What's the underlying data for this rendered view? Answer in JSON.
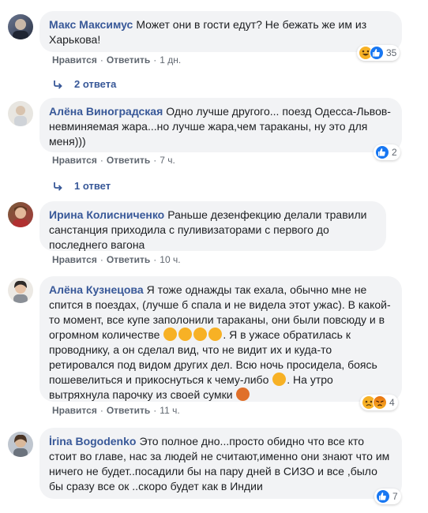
{
  "actions": {
    "like": "Нравится",
    "reply": "Ответить",
    "sep": "·"
  },
  "comments": [
    {
      "author": "Макс Максимус",
      "text": "Может они в гости едут? Не бежать же им из Харькова!",
      "time": "1 дн.",
      "reactions": [
        "haha-icon",
        "like-icon"
      ],
      "reaction_count": "35",
      "replies": "2 ответа"
    },
    {
      "author": "Алёна Виноградская",
      "text": "Одно лучше другого... поезд Одесса-Львов- невминяемая жара...но лучше жара,чем тараканы, ну это для меня)))",
      "time": "7 ч.",
      "reactions": [
        "like-icon"
      ],
      "reaction_count": "2",
      "replies": "1 ответ"
    },
    {
      "author": "Ирина Колисниченко",
      "text": "Раньше дезенфекцию делали травили санстанция приходила с пуливизаторами с первого до последнего вагона",
      "time": "10 ч."
    },
    {
      "author": "Алёна Кузнецова",
      "text_a": "Я тоже однажды так ехала, обычно мне не спится в поездах, (лучше б спала и не видела этот ужас). В какой-то момент, все купе заполонили тараканы, они были повсюду и в огромном количестве",
      "text_b": ". Я в ужасе обратилась к проводнику, а он сделал вид, что не видит их и куда-то ретировался под видом других дел. Всю ночь просидела, боясь пошевелиться и прикоснуться к чему-либо",
      "text_c": ". На утро вытряхнула парочку из своей сумки",
      "time": "11 ч.",
      "reactions": [
        "sad-icon",
        "angry-icon"
      ],
      "reaction_count": "4"
    },
    {
      "author": "İrina Bogodenko",
      "text": "Это полное дно...просто обидно что все кто стоит во главе, нас за людей не считают,именно они знают что им ничего не будет..посадили бы на пару дней в СИЗО и все ,было бы сразу все ок ..скоро будет как в Индии",
      "reactions": [
        "like-icon"
      ],
      "reaction_count": "7"
    }
  ]
}
